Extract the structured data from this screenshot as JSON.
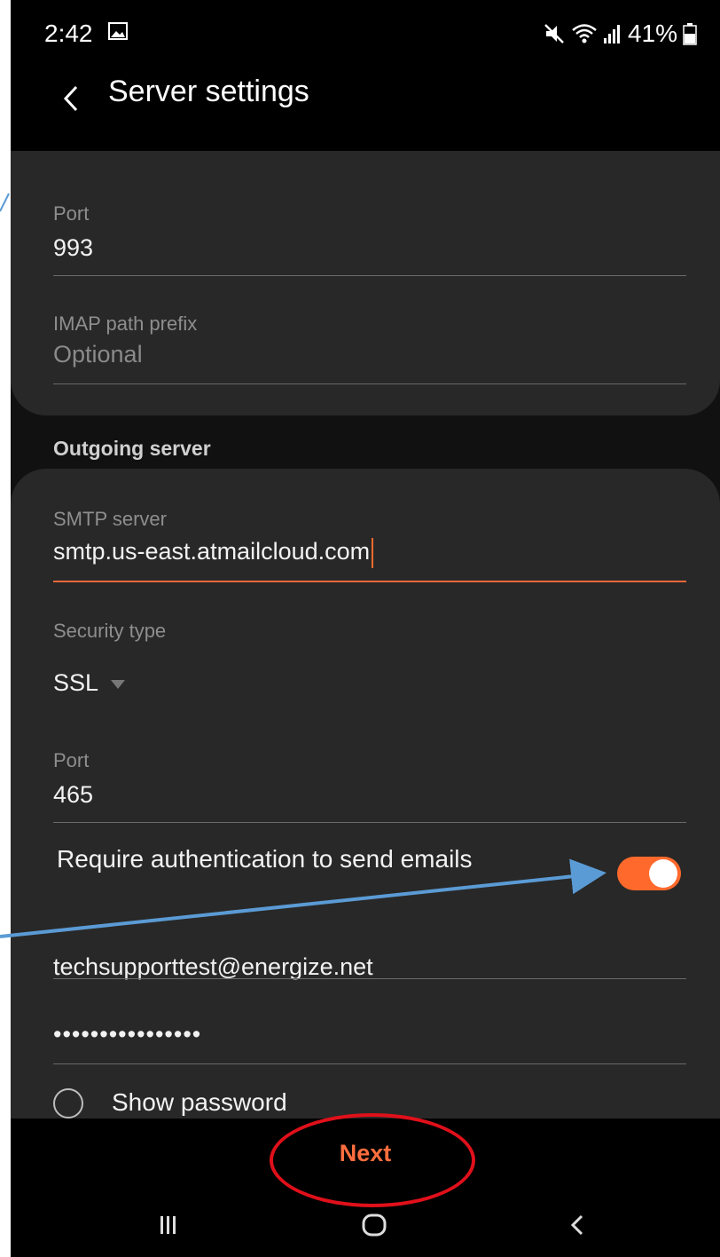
{
  "status": {
    "time": "2:42",
    "battery": "41%"
  },
  "appbar": {
    "title": "Server settings"
  },
  "incoming": {
    "port_label": "Port",
    "port_value": "993",
    "prefix_label": "IMAP path prefix",
    "prefix_placeholder": "Optional"
  },
  "outgoing": {
    "section_title": "Outgoing server",
    "smtp_label": "SMTP server",
    "smtp_value": "smtp.us-east.atmailcloud.com",
    "security_label": "Security type",
    "security_value": "SSL",
    "port_label": "Port",
    "port_value": "465",
    "auth_label": "Require authentication to send emails",
    "auth_enabled": true,
    "username_value": "techsupporttest@energize.net",
    "password_value": "••••••••••••••••",
    "show_password_label": "Show password"
  },
  "footer": {
    "next_label": "Next"
  },
  "colors": {
    "accent": "#ff6a2c",
    "annotation_arrow": "#5b9bd5",
    "annotation_circle": "#e0101a"
  },
  "icons": [
    "image-icon",
    "mute-icon",
    "wifi-icon",
    "signal-icon",
    "battery-icon",
    "back-arrow-icon",
    "dropdown-arrow-icon",
    "recents-icon",
    "home-icon",
    "nav-back-icon"
  ]
}
